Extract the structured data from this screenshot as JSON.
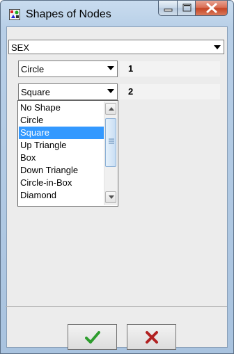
{
  "window": {
    "title": "Shapes of Nodes",
    "icons": [
      "app-icon",
      "minimize-icon",
      "maximize-icon",
      "close-icon"
    ]
  },
  "variable_select": {
    "value": "SEX"
  },
  "rows": [
    {
      "shape": "Circle",
      "value": "1"
    },
    {
      "shape": "Square",
      "value": "2"
    }
  ],
  "shape_options": [
    "No Shape",
    "Circle",
    "Square",
    "Up Triangle",
    "Box",
    "Down Triangle",
    "Circle-in-Box",
    "Diamond"
  ],
  "selected_option": "Square",
  "buttons": {
    "ok_icon": "checkmark-icon",
    "cancel_icon": "x-mark-icon"
  },
  "colors": {
    "selection": "#3399ff",
    "checkmark": "#2e9d2e",
    "cancel": "#b22222",
    "close_button": "#c44222"
  }
}
